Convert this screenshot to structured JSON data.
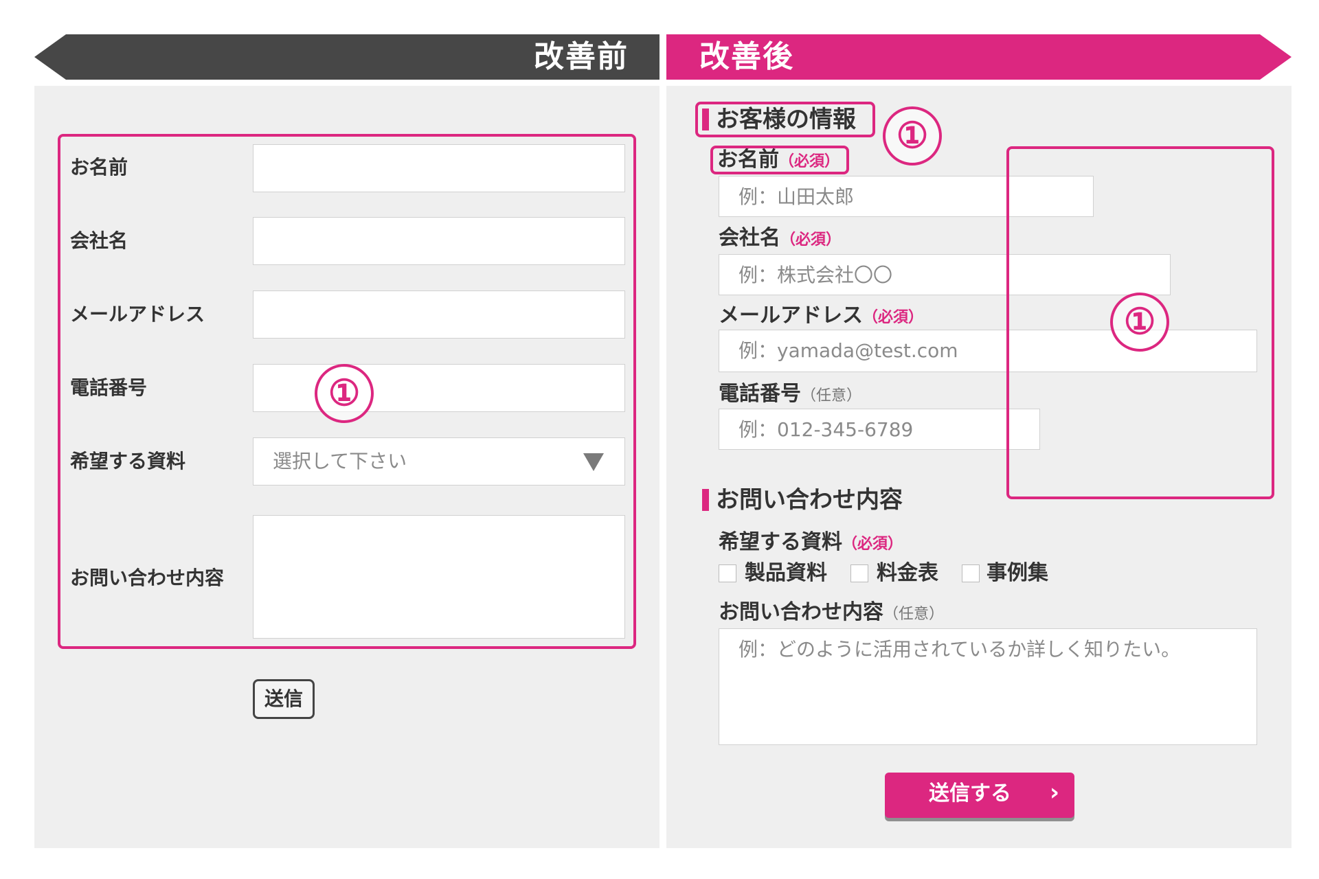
{
  "colors": {
    "accent": "#dc2780",
    "before_banner": "#474747",
    "panel_bg": "#efefef"
  },
  "headers": {
    "before": "改善前",
    "after": "改善後"
  },
  "marker": "①",
  "before_form": {
    "fields": [
      "お名前",
      "会社名",
      "メールアドレス",
      "電話番号",
      "希望する資料",
      "お問い合わせ内容"
    ],
    "select_placeholder": "選択して下さい",
    "select_icon": "triangle-down-icon",
    "submit_label": "送信"
  },
  "after_form": {
    "section1_title": "お客様の情報",
    "name": {
      "label": "お名前",
      "tag": "（必須）",
      "placeholder": "例：山田太郎"
    },
    "company": {
      "label": "会社名",
      "tag": "（必須）",
      "placeholder": "例：株式会社〇〇"
    },
    "email": {
      "label": "メールアドレス",
      "tag": "（必須）",
      "placeholder": "例：yamada@test.com"
    },
    "phone": {
      "label": "電話番号",
      "tag": "（任意）",
      "placeholder": "例：012-345-6789"
    },
    "section2_title": "お問い合わせ内容",
    "material": {
      "label": "希望する資料",
      "tag": "（必須）",
      "options": [
        "製品資料",
        "料金表",
        "事例集"
      ]
    },
    "inquiry": {
      "label": "お問い合わせ内容",
      "tag": "（任意）",
      "placeholder": "例：どのように活用されているか詳しく知りたい。"
    },
    "submit_label": "送信する",
    "submit_icon": "chevron-right-icon",
    "submit_arrow": "›"
  }
}
